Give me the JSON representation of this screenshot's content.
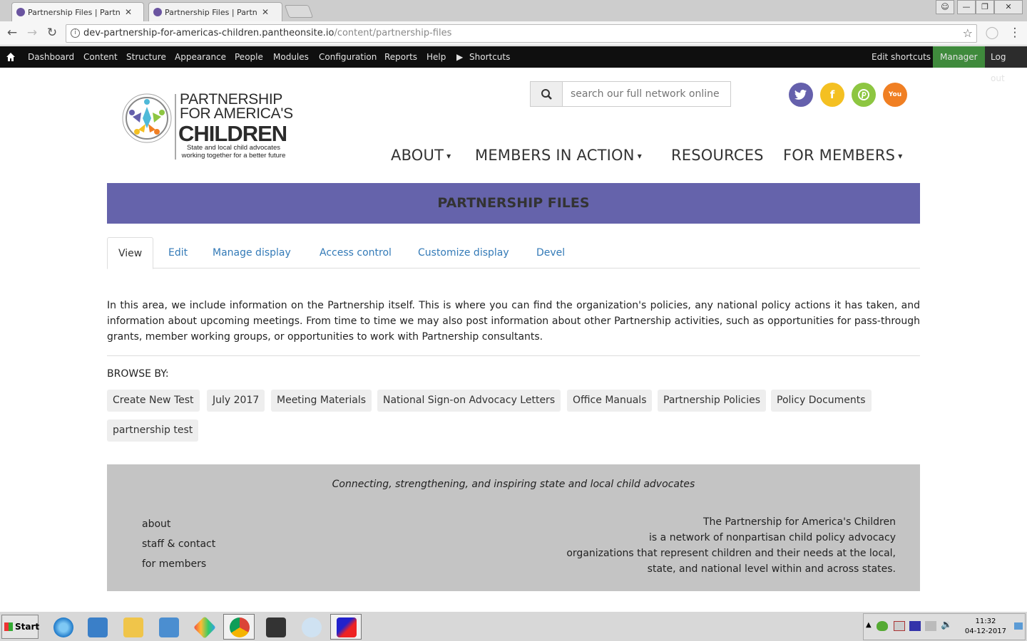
{
  "browser": {
    "tabs": [
      {
        "title": "Partnership Files | Partnership for America's Children"
      },
      {
        "title": "Partnership Files | Partnership for America's Children"
      }
    ],
    "url_host": "dev-partnership-for-americas-children.pantheonsite.io",
    "url_path": "/content/partnership-files"
  },
  "admin_toolbar": {
    "items": [
      "Dashboard",
      "Content",
      "Structure",
      "Appearance",
      "People",
      "Modules",
      "Configuration",
      "Reports",
      "Help",
      "Shortcuts"
    ],
    "edit_shortcuts": "Edit shortcuts",
    "manager": "Manager",
    "logout": "Log out"
  },
  "logo": {
    "line1": "PARTNERSHIP",
    "line2": "FOR AMERICA'S",
    "line3": "CHILDREN",
    "tagline1": "State and local child advocates",
    "tagline2": "working together for a better future"
  },
  "search": {
    "placeholder": "search our full network online"
  },
  "social": {
    "twitter": "#6560ac",
    "facebook": "#f4c022",
    "pinterest": "#8dc641",
    "youtube": "#f07f23"
  },
  "nav": {
    "about": "ABOUT",
    "members_in_action": "MEMBERS IN ACTION",
    "resources": "RESOURCES",
    "for_members": "FOR MEMBERS"
  },
  "page": {
    "title": "PARTNERSHIP FILES",
    "tabs": [
      "View",
      "Edit",
      "Manage display",
      "Access control",
      "Customize display",
      "Devel"
    ],
    "intro": "In this area, we include information on the Partnership itself. This is where you can find the organization's policies, any national policy actions it has taken, and information about upcoming meetings. From time to time we may also post information about other Partnership activities, such as opportunities for pass-through grants, member working groups, or opportunities to work with Partnership consultants.",
    "browse_label": "BROWSE BY:",
    "categories": [
      "Create New Test",
      "July 2017",
      "Meeting Materials",
      "National Sign-on Advocacy Letters",
      "Office Manuals",
      "Partnership Policies",
      "Policy Documents",
      "partnership test"
    ]
  },
  "footer": {
    "tagline": "Connecting, strengthening, and inspiring state and local child advocates",
    "links": [
      "about",
      "staff & contact",
      "for members"
    ],
    "desc": [
      "The Partnership for America's Children",
      "is a network of nonpartisan child policy advocacy",
      "organizations that represent children and their needs at the local,",
      "state, and national level within and across states."
    ]
  },
  "taskbar": {
    "start": "Start",
    "time": "11:32",
    "date": "04-12-2017"
  }
}
